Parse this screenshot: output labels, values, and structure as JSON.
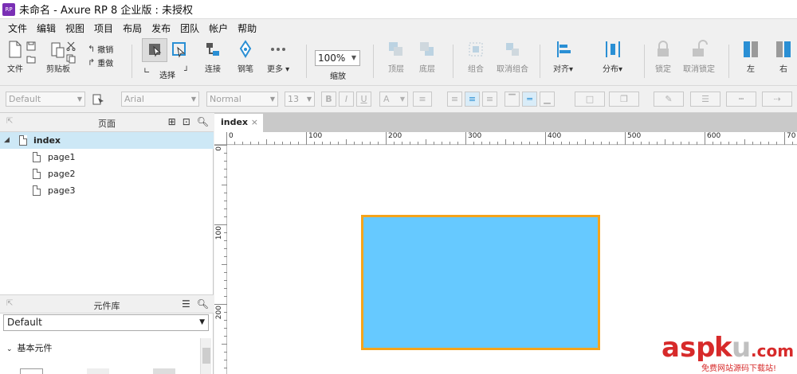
{
  "window": {
    "title": "未命名 - Axure RP 8 企业版 : 未授权",
    "app_icon_text": "RP"
  },
  "menu": [
    "文件",
    "编辑",
    "视图",
    "项目",
    "布局",
    "发布",
    "团队",
    "帐户",
    "帮助"
  ],
  "toolbar": {
    "file": "文件",
    "clipboard": "剪贴板",
    "undo": "撤销",
    "redo": "重做",
    "select": "选择",
    "connect": "连接",
    "pen": "钢笔",
    "more": "更多",
    "zoom_value": "100%",
    "zoom": "缩放",
    "top": "顶层",
    "bottom": "底层",
    "group": "组合",
    "ungroup": "取消组合",
    "align": "对齐",
    "distribute": "分布",
    "lock": "锁定",
    "unlock": "取消锁定",
    "left": "左",
    "right": "右"
  },
  "format": {
    "style": "Default",
    "font": "Arial",
    "weight": "Normal",
    "size": "13",
    "bold": "B",
    "italic": "I",
    "underline": "U",
    "font_color": "A"
  },
  "pages_panel": {
    "title": "页面",
    "root": "index",
    "pages": [
      "page1",
      "page2",
      "page3"
    ]
  },
  "library_panel": {
    "title": "元件库",
    "selected_library": "Default",
    "section": "基本元件"
  },
  "document": {
    "tab": "index",
    "close_glyph": "×",
    "ruler_h": [
      "0",
      "100",
      "200",
      "300",
      "400",
      "500",
      "600",
      "70"
    ],
    "ruler_v": [
      "0",
      "100",
      "200"
    ]
  },
  "colors": {
    "rect_fill": "#66c9ff",
    "rect_border": "#f5a41b",
    "selection": "#cde8f6",
    "accent_blue": "#2a8fd4"
  },
  "watermark": {
    "brand": "aspku.com",
    "caption": "免费网站源码下载站!"
  }
}
